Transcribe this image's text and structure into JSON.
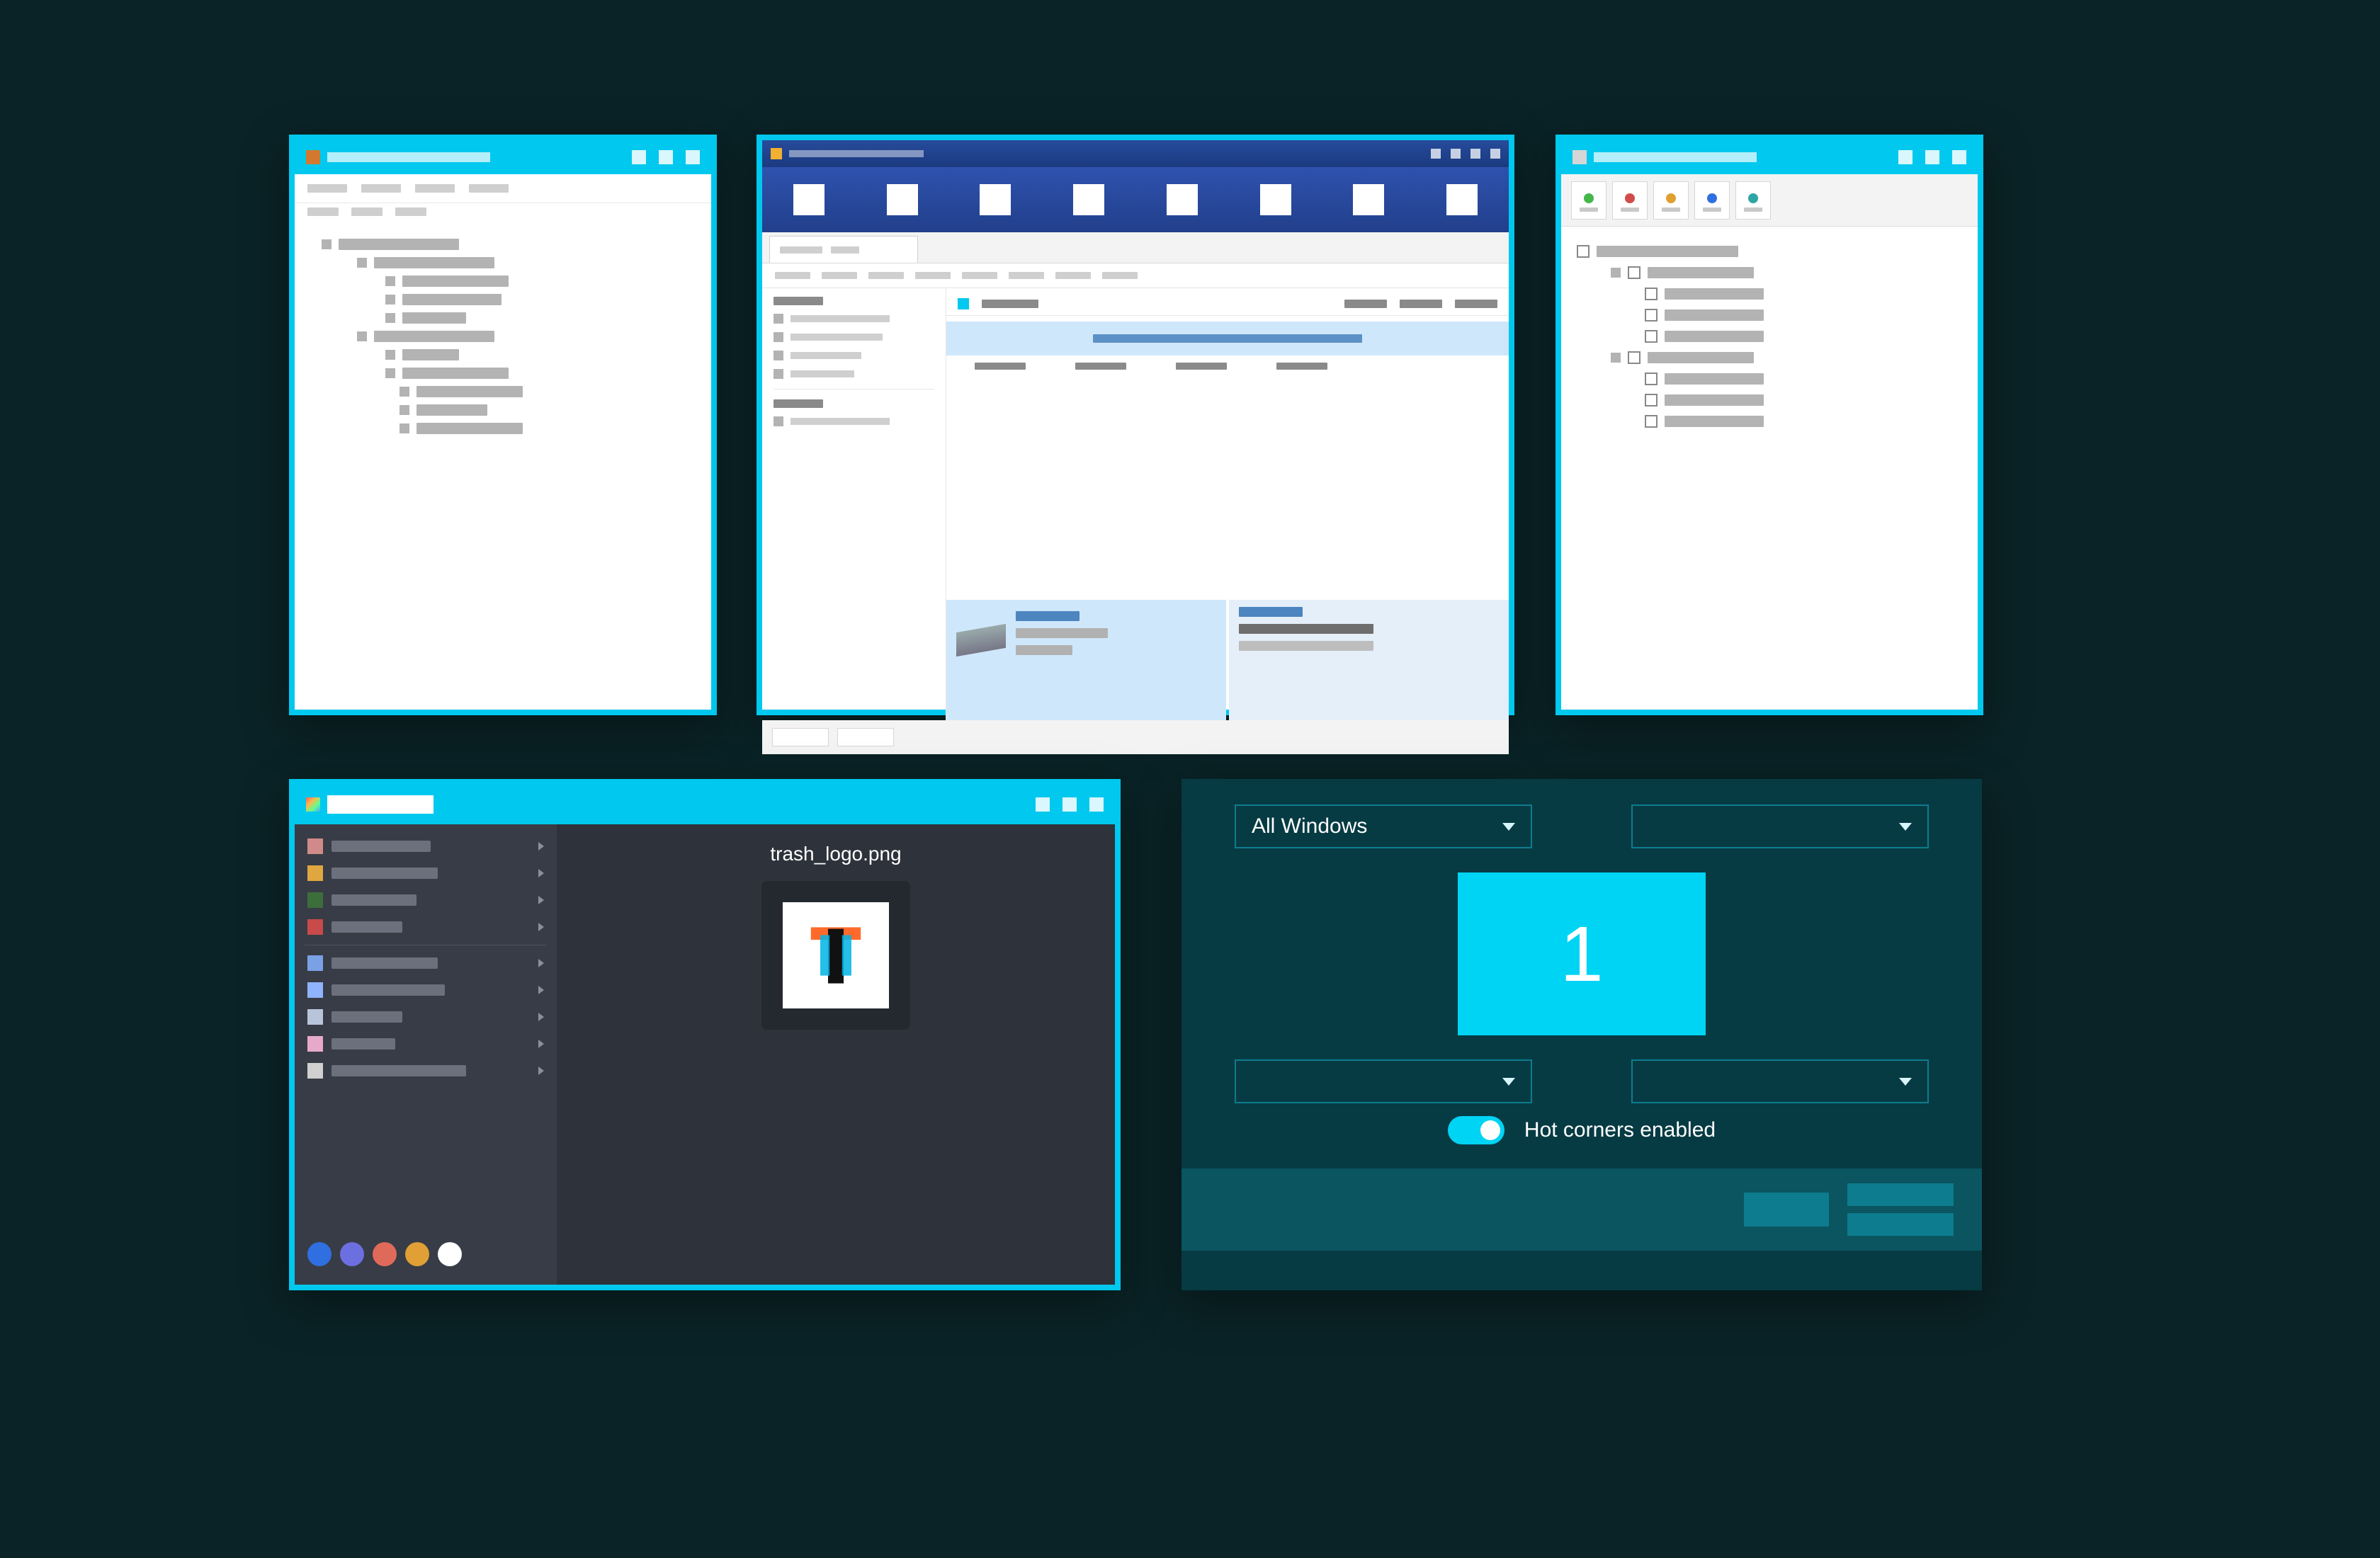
{
  "hotcorners": {
    "top_left_option": "All Windows",
    "preview_number": "1",
    "toggle_label": "Hot corners enabled"
  },
  "file_browser": {
    "selected_filename": "trash_logo.png",
    "side_colors": [
      "#d08a8a",
      "#e0a640",
      "#3c6e3c",
      "#c84a4a",
      "#7aa0e6",
      "#8fb3ff",
      "#b8c4d9",
      "#e6a9c9",
      "#d0d0d0"
    ],
    "side_widths": [
      140,
      150,
      120,
      100,
      150,
      160,
      100,
      90,
      190
    ],
    "palette_dots": [
      "#2f6fe0",
      "#6c6fe0",
      "#e06a5a",
      "#e0a035",
      "#ffffff"
    ]
  },
  "checkbox_tree": {
    "tab_colors": [
      "#45b64a",
      "#d14b4b",
      "#e0a030",
      "#2f6fe0",
      "#30a5a5"
    ]
  }
}
